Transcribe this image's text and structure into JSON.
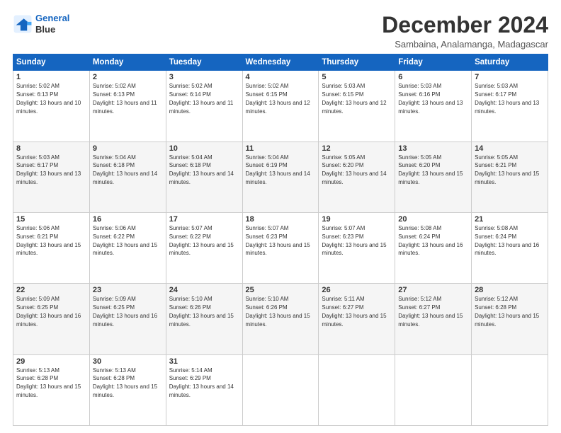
{
  "logo": {
    "line1": "General",
    "line2": "Blue"
  },
  "title": "December 2024",
  "subtitle": "Sambaina, Analamanga, Madagascar",
  "calendar": {
    "headers": [
      "Sunday",
      "Monday",
      "Tuesday",
      "Wednesday",
      "Thursday",
      "Friday",
      "Saturday"
    ],
    "weeks": [
      [
        {
          "day": null
        },
        {
          "day": 2,
          "sunrise": "5:02 AM",
          "sunset": "6:13 PM",
          "daylight": "13 hours and 11 minutes."
        },
        {
          "day": 3,
          "sunrise": "5:02 AM",
          "sunset": "6:14 PM",
          "daylight": "13 hours and 11 minutes."
        },
        {
          "day": 4,
          "sunrise": "5:02 AM",
          "sunset": "6:15 PM",
          "daylight": "13 hours and 12 minutes."
        },
        {
          "day": 5,
          "sunrise": "5:03 AM",
          "sunset": "6:15 PM",
          "daylight": "13 hours and 12 minutes."
        },
        {
          "day": 6,
          "sunrise": "5:03 AM",
          "sunset": "6:16 PM",
          "daylight": "13 hours and 13 minutes."
        },
        {
          "day": 7,
          "sunrise": "5:03 AM",
          "sunset": "6:17 PM",
          "daylight": "13 hours and 13 minutes."
        }
      ],
      [
        {
          "day": 1,
          "sunrise": "5:02 AM",
          "sunset": "6:13 PM",
          "daylight": "13 hours and 10 minutes."
        },
        {
          "day": 9,
          "sunrise": "5:04 AM",
          "sunset": "6:18 PM",
          "daylight": "13 hours and 14 minutes."
        },
        {
          "day": 10,
          "sunrise": "5:04 AM",
          "sunset": "6:18 PM",
          "daylight": "13 hours and 14 minutes."
        },
        {
          "day": 11,
          "sunrise": "5:04 AM",
          "sunset": "6:19 PM",
          "daylight": "13 hours and 14 minutes."
        },
        {
          "day": 12,
          "sunrise": "5:05 AM",
          "sunset": "6:20 PM",
          "daylight": "13 hours and 14 minutes."
        },
        {
          "day": 13,
          "sunrise": "5:05 AM",
          "sunset": "6:20 PM",
          "daylight": "13 hours and 15 minutes."
        },
        {
          "day": 14,
          "sunrise": "5:05 AM",
          "sunset": "6:21 PM",
          "daylight": "13 hours and 15 minutes."
        }
      ],
      [
        {
          "day": 8,
          "sunrise": "5:03 AM",
          "sunset": "6:17 PM",
          "daylight": "13 hours and 13 minutes."
        },
        {
          "day": 16,
          "sunrise": "5:06 AM",
          "sunset": "6:22 PM",
          "daylight": "13 hours and 15 minutes."
        },
        {
          "day": 17,
          "sunrise": "5:07 AM",
          "sunset": "6:22 PM",
          "daylight": "13 hours and 15 minutes."
        },
        {
          "day": 18,
          "sunrise": "5:07 AM",
          "sunset": "6:23 PM",
          "daylight": "13 hours and 15 minutes."
        },
        {
          "day": 19,
          "sunrise": "5:07 AM",
          "sunset": "6:23 PM",
          "daylight": "13 hours and 15 minutes."
        },
        {
          "day": 20,
          "sunrise": "5:08 AM",
          "sunset": "6:24 PM",
          "daylight": "13 hours and 16 minutes."
        },
        {
          "day": 21,
          "sunrise": "5:08 AM",
          "sunset": "6:24 PM",
          "daylight": "13 hours and 16 minutes."
        }
      ],
      [
        {
          "day": 15,
          "sunrise": "5:06 AM",
          "sunset": "6:21 PM",
          "daylight": "13 hours and 15 minutes."
        },
        {
          "day": 23,
          "sunrise": "5:09 AM",
          "sunset": "6:25 PM",
          "daylight": "13 hours and 16 minutes."
        },
        {
          "day": 24,
          "sunrise": "5:10 AM",
          "sunset": "6:26 PM",
          "daylight": "13 hours and 15 minutes."
        },
        {
          "day": 25,
          "sunrise": "5:10 AM",
          "sunset": "6:26 PM",
          "daylight": "13 hours and 15 minutes."
        },
        {
          "day": 26,
          "sunrise": "5:11 AM",
          "sunset": "6:27 PM",
          "daylight": "13 hours and 15 minutes."
        },
        {
          "day": 27,
          "sunrise": "5:12 AM",
          "sunset": "6:27 PM",
          "daylight": "13 hours and 15 minutes."
        },
        {
          "day": 28,
          "sunrise": "5:12 AM",
          "sunset": "6:28 PM",
          "daylight": "13 hours and 15 minutes."
        }
      ],
      [
        {
          "day": 22,
          "sunrise": "5:09 AM",
          "sunset": "6:25 PM",
          "daylight": "13 hours and 16 minutes."
        },
        {
          "day": 30,
          "sunrise": "5:13 AM",
          "sunset": "6:28 PM",
          "daylight": "13 hours and 15 minutes."
        },
        {
          "day": 31,
          "sunrise": "5:14 AM",
          "sunset": "6:29 PM",
          "daylight": "13 hours and 14 minutes."
        },
        {
          "day": null
        },
        {
          "day": null
        },
        {
          "day": null
        },
        {
          "day": null
        }
      ],
      [
        {
          "day": 29,
          "sunrise": "5:13 AM",
          "sunset": "6:28 PM",
          "daylight": "13 hours and 15 minutes."
        },
        {
          "day": null
        },
        {
          "day": null
        },
        {
          "day": null
        },
        {
          "day": null
        },
        {
          "day": null
        },
        {
          "day": null
        }
      ]
    ]
  }
}
